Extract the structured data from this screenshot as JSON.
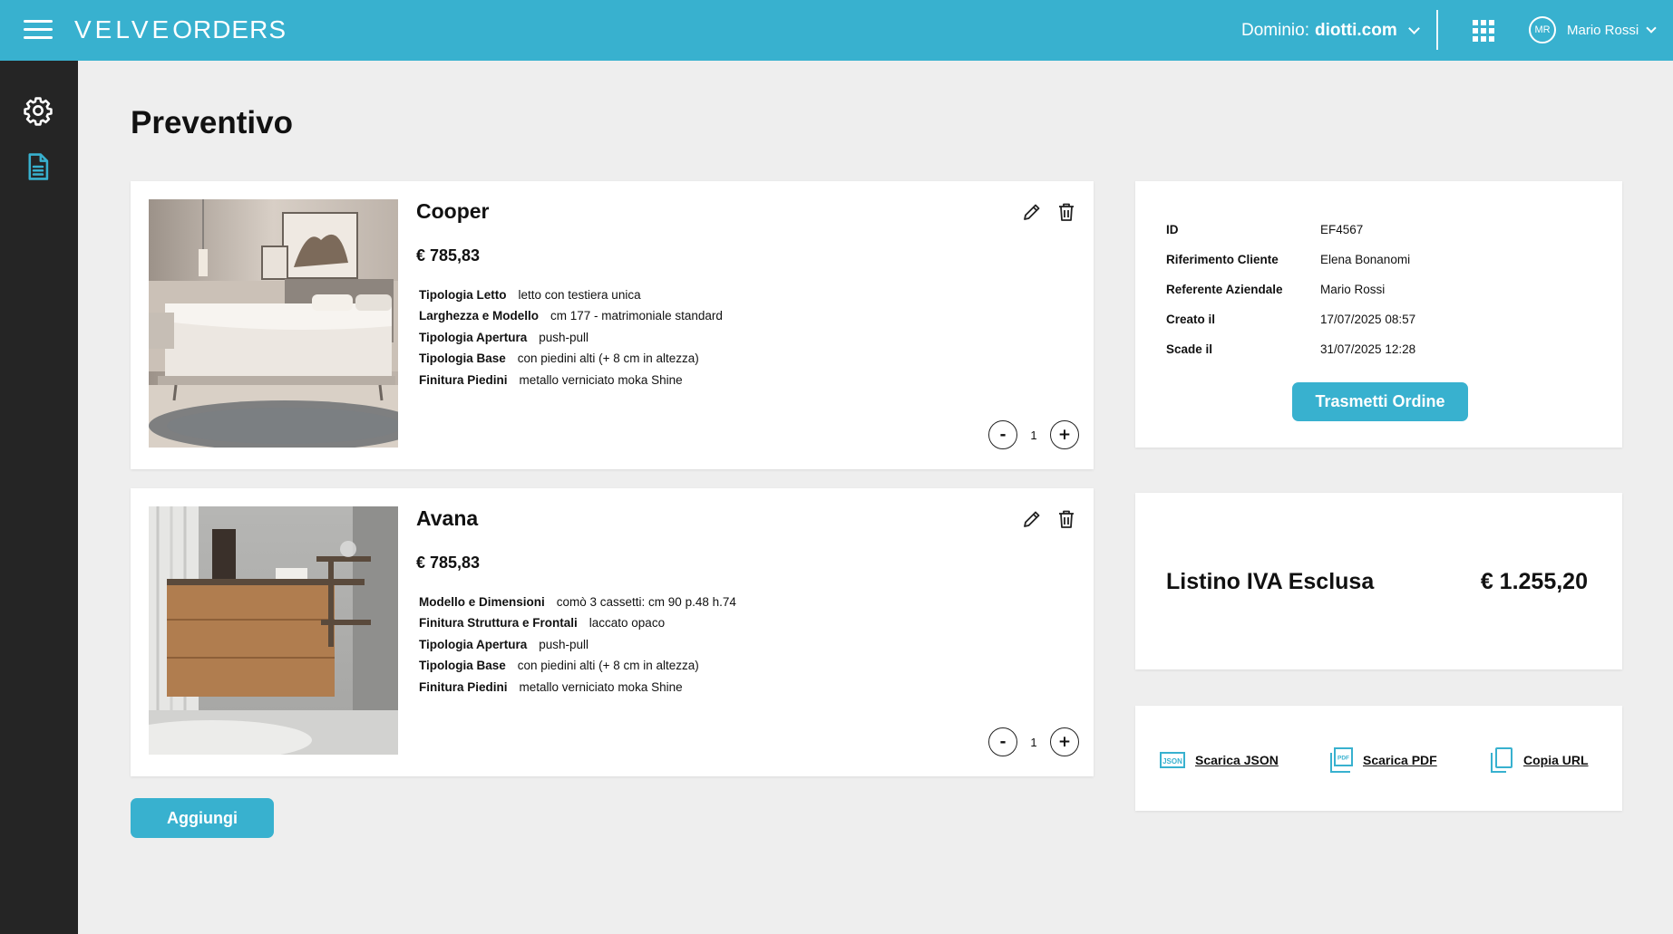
{
  "header": {
    "logo_velve": "VELVE",
    "logo_orders": "ORDERS",
    "domain_label": "Dominio:",
    "domain_value": "diotti.com",
    "user_initials": "MR",
    "user_name": "Mario Rossi"
  },
  "sidebar": {
    "items": [
      {
        "name": "settings",
        "icon": "gear-icon"
      },
      {
        "name": "document",
        "icon": "document-icon"
      }
    ]
  },
  "page": {
    "title": "Preventivo"
  },
  "products": [
    {
      "name": "Cooper",
      "price": "€ 785,83",
      "specs": [
        {
          "key": "Tipologia Letto",
          "value": "letto con testiera unica"
        },
        {
          "key": "Larghezza e Modello",
          "value": "cm 177 - matrimoniale standard"
        },
        {
          "key": "Tipologia Apertura",
          "value": "push-pull"
        },
        {
          "key": "Tipologia Base",
          "value": "con piedini alti (+ 8 cm in altezza)"
        },
        {
          "key": "Finitura Piedini",
          "value": "metallo verniciato moka Shine"
        }
      ],
      "quantity": "1",
      "minus": "-",
      "plus": "+"
    },
    {
      "name": "Avana",
      "price": "€ 785,83",
      "specs": [
        {
          "key": "Modello e Dimensioni",
          "value": "comò 3 cassetti: cm 90 p.48 h.74"
        },
        {
          "key": "Finitura Struttura e Frontali",
          "value": "laccato opaco"
        },
        {
          "key": "Tipologia Apertura",
          "value": "push-pull"
        },
        {
          "key": "Tipologia Base",
          "value": "con piedini alti (+ 8 cm in altezza)"
        },
        {
          "key": "Finitura Piedini",
          "value": "metallo verniciato moka Shine"
        }
      ],
      "quantity": "1",
      "minus": "-",
      "plus": "+"
    }
  ],
  "add_button": "Aggiungi",
  "order_info": {
    "rows": [
      {
        "key": "ID",
        "value": "EF4567"
      },
      {
        "key": "Riferimento Cliente",
        "value": "Elena Bonanomi"
      },
      {
        "key": "Referente Aziendale",
        "value": "Mario Rossi"
      },
      {
        "key": "Creato il",
        "value": "17/07/2025 08:57"
      },
      {
        "key": "Scade il",
        "value": "31/07/2025 12:28"
      }
    ],
    "submit_button": "Trasmetti Ordine"
  },
  "total": {
    "label": "Listino IVA Esclusa",
    "amount": "€ 1.255,20"
  },
  "downloads": {
    "json": "Scarica JSON",
    "json_icon_text": "JSON",
    "pdf": "Scarica PDF",
    "pdf_icon_text": "PDF",
    "copy": "Copia URL"
  },
  "colors": {
    "accent": "#38b1cf",
    "sidebar": "#252525",
    "background": "#eeeeee"
  }
}
